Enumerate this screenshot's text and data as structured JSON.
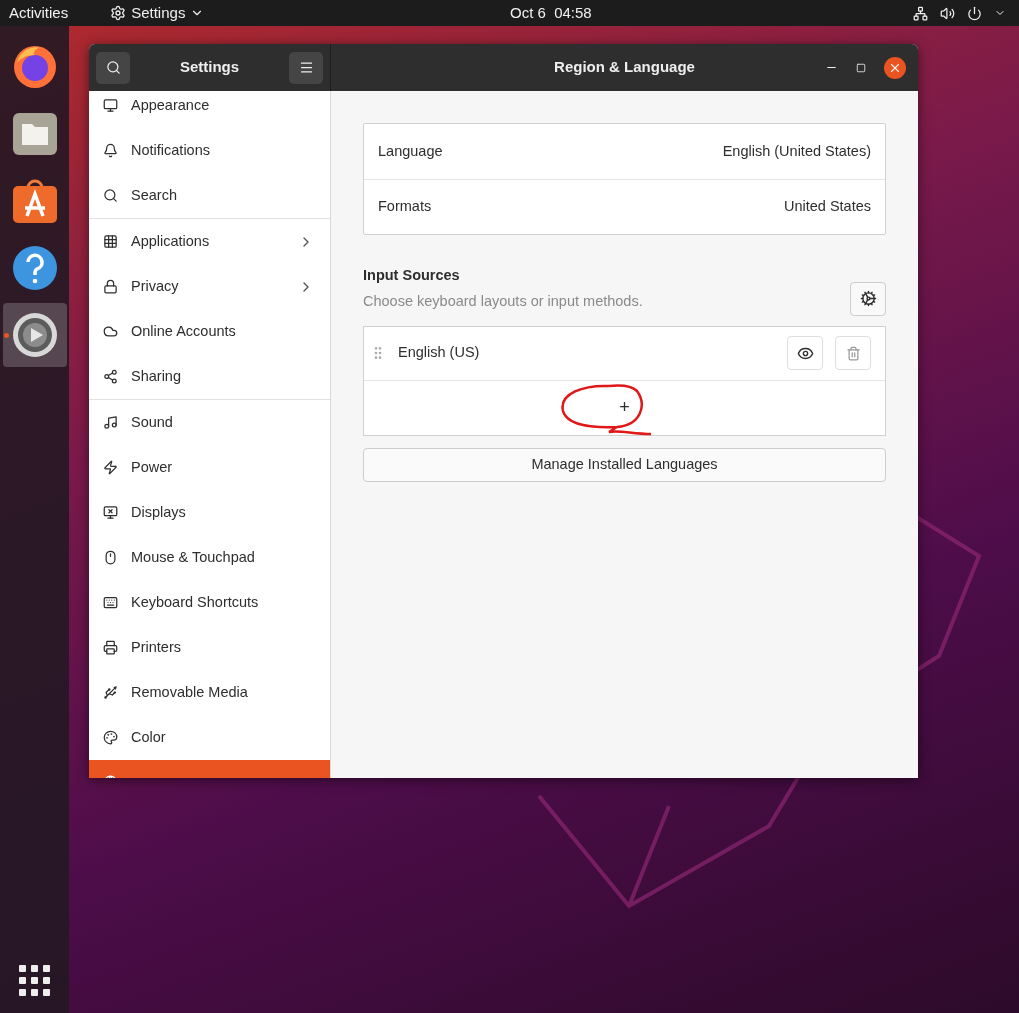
{
  "top_bar": {
    "activities": "Activities",
    "app_menu": "Settings",
    "clock": "Oct 6  04:58"
  },
  "dock": [
    {
      "selected": false
    },
    {
      "selected": false
    },
    {
      "selected": false
    },
    {
      "selected": false
    },
    {
      "selected": true
    }
  ],
  "window": {
    "sidebar_title": "Settings",
    "title": "Region & Language"
  },
  "sidebar": {
    "sections": [
      {
        "items": [
          {
            "label": "Appearance",
            "selected": false,
            "chevron": false
          },
          {
            "label": "Notifications",
            "selected": false,
            "chevron": false
          },
          {
            "label": "Search",
            "selected": false,
            "chevron": false
          }
        ]
      },
      {
        "items": [
          {
            "label": "Applications",
            "selected": false,
            "chevron": true
          },
          {
            "label": "Privacy",
            "selected": false,
            "chevron": true
          },
          {
            "label": "Online Accounts",
            "selected": false,
            "chevron": false
          },
          {
            "label": "Sharing",
            "selected": false,
            "chevron": false
          }
        ]
      },
      {
        "items": [
          {
            "label": "Sound",
            "selected": false,
            "chevron": false
          },
          {
            "label": "Power",
            "selected": false,
            "chevron": false
          },
          {
            "label": "Displays",
            "selected": false,
            "chevron": false
          },
          {
            "label": "Mouse & Touchpad",
            "selected": false,
            "chevron": false
          },
          {
            "label": "Keyboard Shortcuts",
            "selected": false,
            "chevron": false
          },
          {
            "label": "Printers",
            "selected": false,
            "chevron": false
          },
          {
            "label": "Removable Media",
            "selected": false,
            "chevron": false
          },
          {
            "label": "Color",
            "selected": false,
            "chevron": false
          },
          {
            "selected": true,
            "chevron": false
          }
        ]
      }
    ]
  },
  "settings": [
    {
      "label": "Language",
      "value": "English (United States)"
    },
    {
      "label": "Formats",
      "value": "United States"
    }
  ],
  "input_sources": {
    "title": "Input Sources",
    "subtitle": "Choose keyboard layouts or input methods.",
    "items": [
      {
        "label": "English (US)"
      }
    ],
    "add_button": "+"
  },
  "manage_button": "Manage Installed Languages"
}
